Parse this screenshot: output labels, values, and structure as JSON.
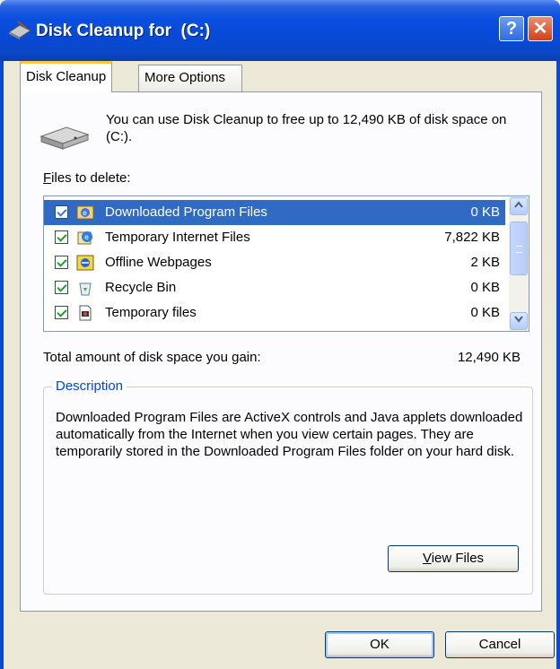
{
  "window": {
    "title": "Disk Cleanup for  (C:)",
    "help_button": "?",
    "close_button": "✕"
  },
  "tabs": [
    {
      "label": "Disk Cleanup",
      "active": true
    },
    {
      "label": "More Options",
      "active": false
    }
  ],
  "intro_text": "You can use Disk Cleanup to free up to 12,490 KB of disk space on  (C:).",
  "files_to_delete": {
    "label_mnemonic": "F",
    "label_rest": "iles to delete:",
    "items": [
      {
        "name": "Downloaded Program Files",
        "size": "0 KB",
        "checked": true,
        "selected": true,
        "icon": "downloaded-program-files-icon"
      },
      {
        "name": "Temporary Internet Files",
        "size": "7,822 KB",
        "checked": true,
        "selected": false,
        "icon": "temporary-internet-files-icon"
      },
      {
        "name": "Offline Webpages",
        "size": "2 KB",
        "checked": true,
        "selected": false,
        "icon": "offline-webpages-icon"
      },
      {
        "name": "Recycle Bin",
        "size": "0 KB",
        "checked": true,
        "selected": false,
        "icon": "recycle-bin-icon"
      },
      {
        "name": "Temporary files",
        "size": "0 KB",
        "checked": true,
        "selected": false,
        "icon": "temporary-files-icon"
      }
    ]
  },
  "total": {
    "label": "Total amount of disk space you gain:",
    "value": "12,490 KB"
  },
  "description": {
    "title": "Description",
    "text": "Downloaded Program Files are ActiveX controls and Java applets downloaded automatically from the Internet when you view certain pages. They are temporarily stored in the Downloaded Program Files folder on your hard disk."
  },
  "buttons": {
    "view_files_mnemonic": "V",
    "view_files_rest": "iew Files",
    "ok": "OK",
    "cancel": "Cancel"
  },
  "colors": {
    "titlebar": "#0A4FE0",
    "selection": "#316AC5",
    "face": "#ECE9D8",
    "group_title": "#0046D5"
  }
}
